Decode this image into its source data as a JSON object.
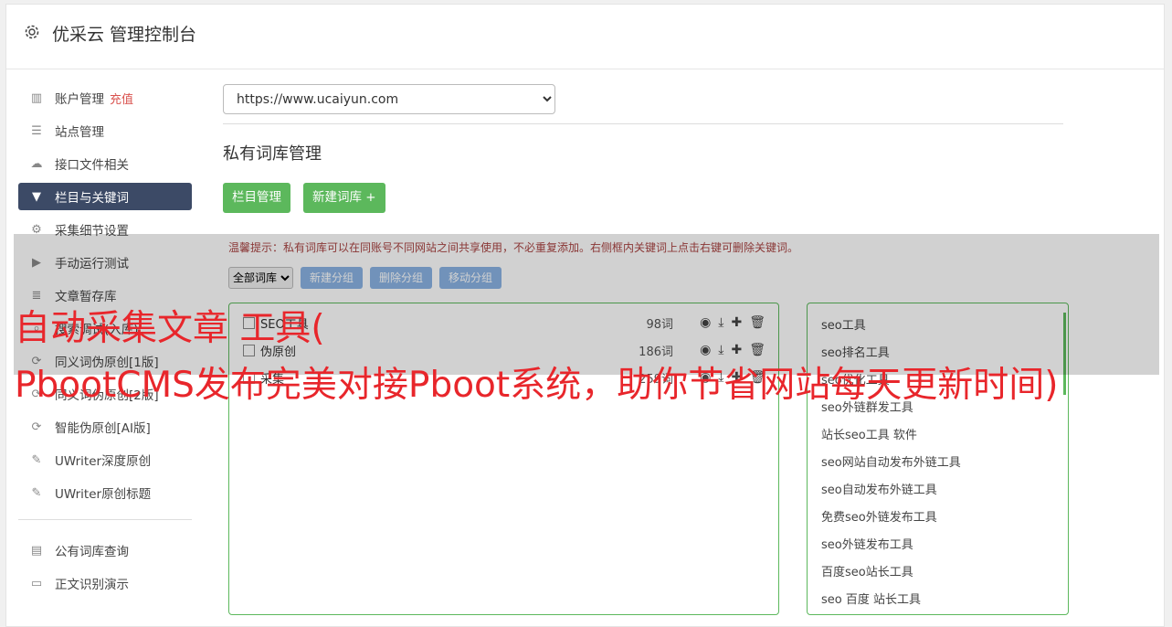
{
  "header": {
    "title": "优采云 管理控制台",
    "icon": "gear-icon"
  },
  "sidebar": {
    "items": [
      {
        "label": "账户管理",
        "badge": "充值",
        "icon": "bar-chart-icon"
      },
      {
        "label": "站点管理",
        "icon": "server-icon"
      },
      {
        "label": "接口文件相关",
        "icon": "cloud-upload-icon"
      },
      {
        "label": "栏目与关键词",
        "icon": "filter-icon",
        "active": true
      },
      {
        "label": "采集细节设置",
        "icon": "cogs-icon"
      },
      {
        "label": "手动运行测试",
        "icon": "play-circle-icon"
      },
      {
        "label": "文章暂存库",
        "icon": "database-icon"
      },
      {
        "label": "搜索调试(入库)",
        "icon": "search-icon"
      },
      {
        "label": "同义词伪原创[1版]",
        "icon": "refresh-icon"
      },
      {
        "label": "同义词伪原创[2版]",
        "icon": "refresh-icon"
      },
      {
        "label": "智能伪原创[AI版]",
        "icon": "refresh-icon"
      },
      {
        "label": "UWriter深度原创",
        "icon": "edit-icon"
      },
      {
        "label": "UWriter原创标题",
        "icon": "edit-icon"
      }
    ],
    "items2": [
      {
        "label": "公有词库查询",
        "icon": "book-icon"
      },
      {
        "label": "正文识别演示",
        "icon": "monitor-icon"
      }
    ]
  },
  "main": {
    "site_select": "https://www.ucaiyun.com",
    "section_title": "私有词库管理",
    "btn_category": "栏目管理",
    "btn_new_lib": "新建词库 +",
    "tip": "温馨提示：私有词库可以在同账号不同网站之间共享使用，不必重复添加。右侧框内关键词上点击右键可删除关键词。",
    "filter_select": "全部词库",
    "btn_new_group": "新建分组",
    "btn_delete_group": "删除分组",
    "btn_move_group": "移动分组"
  },
  "libraries": [
    {
      "name": "SEO工具",
      "count": "98词"
    },
    {
      "name": "伪原创",
      "count": "186词"
    },
    {
      "name": "采集",
      "count": "259词"
    }
  ],
  "keywords": [
    "seo工具",
    "seo排名工具",
    "seo优化工具",
    "seo外链群发工具",
    "站长seo工具 软件",
    "seo网站自动发布外链工具",
    "seo自动发布外链工具",
    "免费seo外链发布工具",
    "seo外链发布工具",
    "百度seo站长工具",
    "seo 百度 站长工具"
  ],
  "overlay": {
    "line1": "自动采集文章 工具(",
    "line2": "PbootCMS发布完美对接Pboot系统，助你节省网站每天更新时间)"
  },
  "colors": {
    "green": "#5cb85c",
    "active_nav": "#3c4a66",
    "overlay_text": "#e8262b",
    "blue_btn": "#8ab3e3"
  }
}
